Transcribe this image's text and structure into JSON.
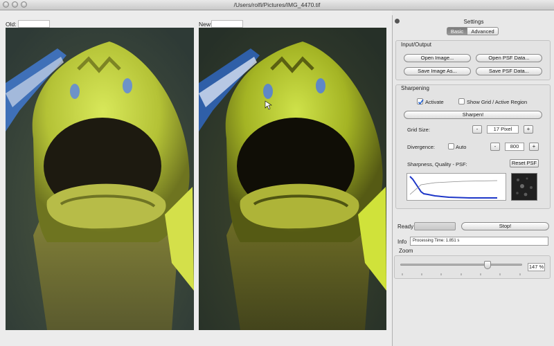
{
  "window": {
    "title": "/Users/rolfi/Pictures/IMG_4470.tif"
  },
  "panes": {
    "old_label": "Old:",
    "new_label": "New:"
  },
  "settings": {
    "title": "Settings",
    "tabs": [
      "Basic",
      "Advanced"
    ],
    "active_tab": "Basic",
    "io": {
      "title": "Input/Output",
      "open_image": "Open Image...",
      "open_psf": "Open PSF Data...",
      "save_image": "Save Image As...",
      "save_psf": "Save PSF Data..."
    },
    "sharpening": {
      "title": "Sharpening",
      "activate": "Activate",
      "activate_checked": true,
      "show_grid": "Show Grid / Active Region",
      "show_grid_checked": false,
      "sharpen_button": "Sharpen!",
      "grid_size_label": "Grid Size:",
      "grid_size_value": "17 Pixel",
      "divergence_label": "Divergence:",
      "auto_label": "Auto",
      "auto_checked": false,
      "divergence_value": "800",
      "minus": "-",
      "plus": "+",
      "psf_label": "Sharpness, Quality - PSF:",
      "reset_psf": "Reset PSF"
    },
    "status": {
      "ready_label": "Ready",
      "stop_button": "Stop!",
      "info_label": "Info",
      "info_text": "Processing Time: 1.851 s"
    },
    "zoom": {
      "title": "Zoom",
      "value": "147 %",
      "slider_fraction": 0.73
    }
  }
}
